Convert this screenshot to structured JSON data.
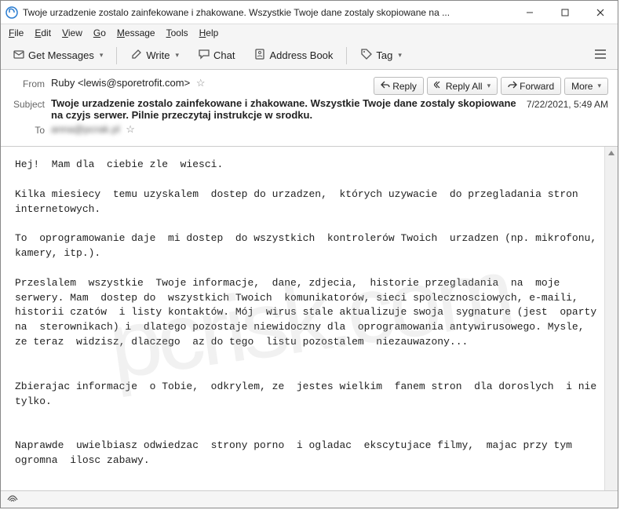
{
  "window": {
    "title": "Twoje urzadzenie zostalo zainfekowane i zhakowane. Wszystkie Twoje dane zostaly skopiowane na ..."
  },
  "menubar": {
    "file": "File",
    "edit": "Edit",
    "view": "View",
    "go": "Go",
    "message": "Message",
    "tools": "Tools",
    "help": "Help"
  },
  "toolbar": {
    "get_messages": "Get Messages",
    "write": "Write",
    "chat": "Chat",
    "address_book": "Address Book",
    "tag": "Tag"
  },
  "actions": {
    "reply": "Reply",
    "reply_all": "Reply All",
    "forward": "Forward",
    "more": "More"
  },
  "headers": {
    "from_label": "From",
    "from_value": "Ruby <lewis@sporetrofit.com>",
    "subject_label": "Subject",
    "subject_value": "Twoje urzadzenie zostalo zainfekowane i zhakowane. Wszystkie Twoje dane zostaly skopiowane na czyjs serwer. Pilnie przeczytaj instrukcje w srodku.",
    "to_label": "To",
    "to_value": "anna@pcrak.pl",
    "date": "7/22/2021, 5:49 AM"
  },
  "body": "Hej!  Mam dla  ciebie zle  wiesci.\n\nKilka miesiecy  temu uzyskalem  dostep do urzadzen,  których uzywacie  do przegladania stron internetowych.\n\nTo  oprogramowanie daje  mi dostep  do wszystkich  kontrolerów Twoich  urzadzen (np. mikrofonu, kamery, itp.).\n\nPrzeslalem  wszystkie  Twoje informacje,  dane, zdjecia,  historie przegladania  na  moje  serwery. Mam  dostep do  wszystkich Twoich  komunikatorów, sieci spolecznosciowych, e-maili,  historii czatów  i listy kontaktów. Mój  wirus stale aktualizuje swoja  sygnature (jest  oparty na  sterownikach) i  dlatego pozostaje niewidoczny dla  oprogramowania antywirusowego. Mysle,  ze teraz  widzisz, dlaczego  az do tego  listu pozostalem  niezauwazony...\n\n\nZbierajac informacje  o Tobie,  odkrylem, ze  jestes wielkim  fanem stron  dla doroslych  i nie  tylko.\n\n\nNaprawde  uwielbiasz odwiedzac  strony porno  i ogladac  ekscytujace filmy,  majac przy tym ogromna  ilosc zabawy.",
  "watermark": "pcrisk.com"
}
